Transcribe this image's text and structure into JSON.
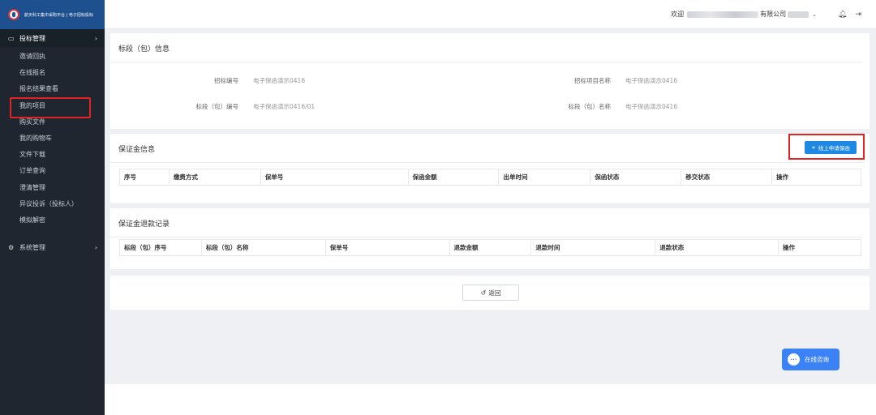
{
  "brand": {
    "text": "航天科工集中采购平台 | 电子招标投标"
  },
  "sidebar": {
    "group_bid": {
      "label": "投标管理"
    },
    "items": [
      {
        "label": "邀请回执"
      },
      {
        "label": "在线报名"
      },
      {
        "label": "报名结果查看"
      },
      {
        "label": "我的项目"
      },
      {
        "label": "购买文件"
      },
      {
        "label": "我的购物车"
      },
      {
        "label": "文件下载"
      },
      {
        "label": "订单查询"
      },
      {
        "label": "澄清管理"
      },
      {
        "label": "异议投诉（投标人）"
      },
      {
        "label": "模拟解密"
      }
    ],
    "group_sys": {
      "label": "系统管理"
    }
  },
  "topbar": {
    "welcome": "欢迎",
    "company": "有限公司"
  },
  "section_info": {
    "title": "标段（包）信息",
    "fields": [
      {
        "label": "招标编号",
        "value": "电子保函演示0416"
      },
      {
        "label": "招标项目名称",
        "value": "电子保函演示0416"
      },
      {
        "label": "标段（包）编号",
        "value": "电子保函演示0416/01"
      },
      {
        "label": "标段（包）名称",
        "value": "电子保函演示0416"
      }
    ]
  },
  "section_deposit": {
    "title": "保证金信息",
    "apply_button": "线上申请保函",
    "columns": [
      "序号",
      "缴费方式",
      "保单号",
      "保函金额",
      "出单时间",
      "保函状态",
      "移交状态",
      "操作"
    ]
  },
  "section_refund": {
    "title": "保证金退款记录",
    "columns": [
      "标段（包）序号",
      "标段（包）名称",
      "保单号",
      "退款金额",
      "退款时间",
      "退款状态",
      "操作"
    ]
  },
  "back_button": "返回",
  "chat_button": "在线咨询"
}
